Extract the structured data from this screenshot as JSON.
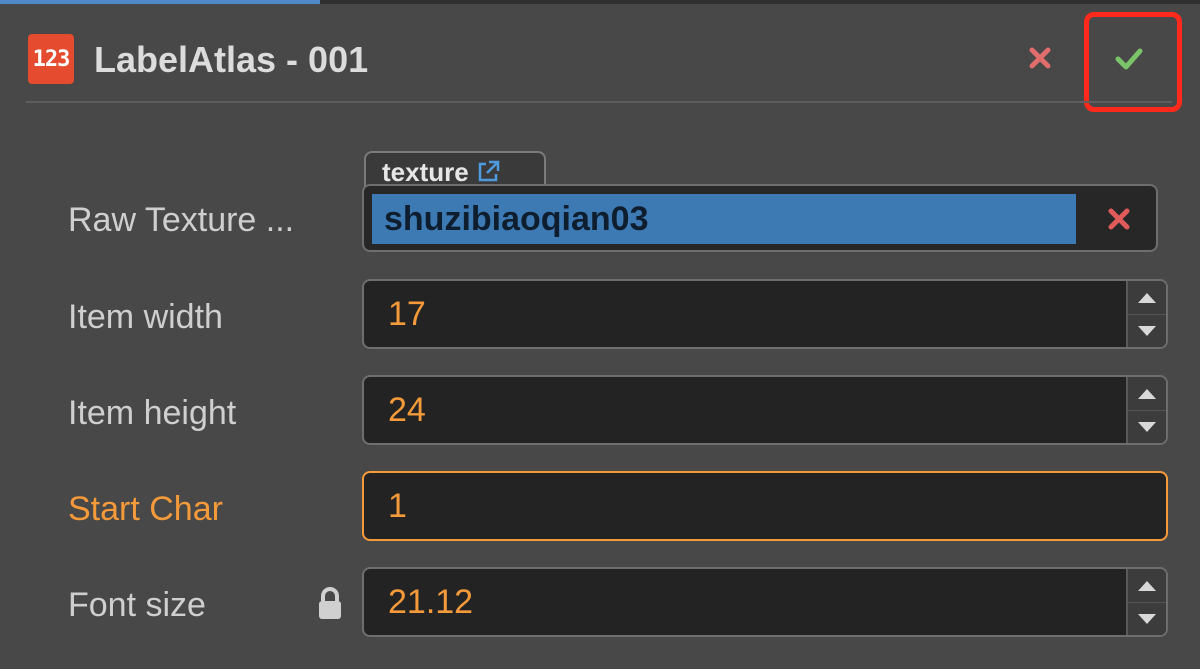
{
  "header": {
    "icon_text": "123",
    "title": "LabelAtlas - 001",
    "close_icon": "close-icon",
    "confirm_icon": "checkmark-icon"
  },
  "properties": {
    "raw_texture": {
      "label": "Raw Texture ...",
      "tab_label": "texture",
      "value": "shuzibiaoqian03"
    },
    "item_width": {
      "label": "Item width",
      "value": "17"
    },
    "item_height": {
      "label": "Item height",
      "value": "24"
    },
    "start_char": {
      "label": "Start Char",
      "value": "1"
    },
    "font_size": {
      "label": "Font size",
      "value": "21.12"
    }
  },
  "colors": {
    "accent_orange": "#f59a3a",
    "selection_blue": "#3d7ab4",
    "close_red": "#e06c6c",
    "confirm_green": "#7cc46a",
    "highlight_red": "#ff2a1c",
    "background": "#484848"
  }
}
